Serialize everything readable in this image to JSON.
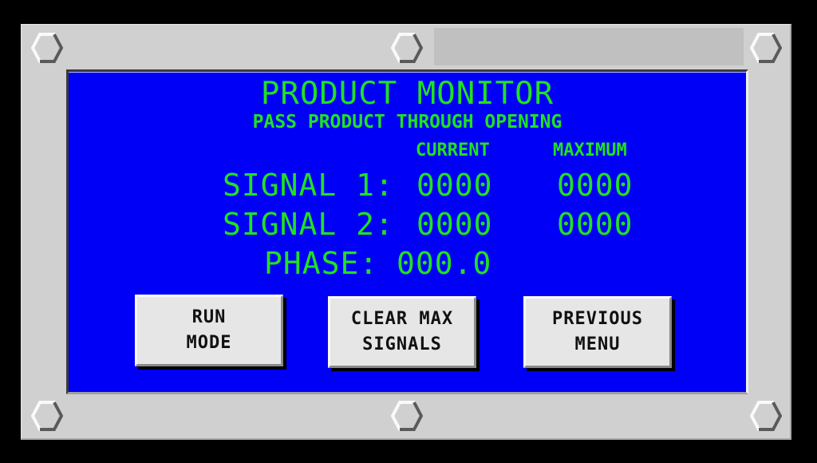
{
  "screen": {
    "title": "PRODUCT MONITOR",
    "instruction": "PASS PRODUCT THROUGH OPENING"
  },
  "columns": {
    "current": "CURRENT",
    "maximum": "MAXIMUM"
  },
  "signals": [
    {
      "label": "SIGNAL 1:",
      "current": "0000",
      "maximum": "0000"
    },
    {
      "label": "SIGNAL 2:",
      "current": "0000",
      "maximum": "0000"
    }
  ],
  "phase": {
    "label": "PHASE:",
    "value": "000.0"
  },
  "buttons": {
    "run_mode": {
      "line1": "RUN",
      "line2": "MODE"
    },
    "clear_max": {
      "line1": "CLEAR MAX",
      "line2": "SIGNALS"
    },
    "previous_menu": {
      "line1": "PREVIOUS",
      "line2": "MENU"
    }
  },
  "icons": {
    "bolts": [
      "hex-bolt-icon",
      "hex-bolt-icon",
      "hex-bolt-icon",
      "hex-bolt-icon",
      "hex-bolt-icon",
      "hex-bolt-icon"
    ]
  },
  "colors": {
    "screen_bg": "#0000f6",
    "text_green": "#22e022",
    "bezel_gray": "#d0d0d0",
    "button_face": "#e6e6e6"
  }
}
